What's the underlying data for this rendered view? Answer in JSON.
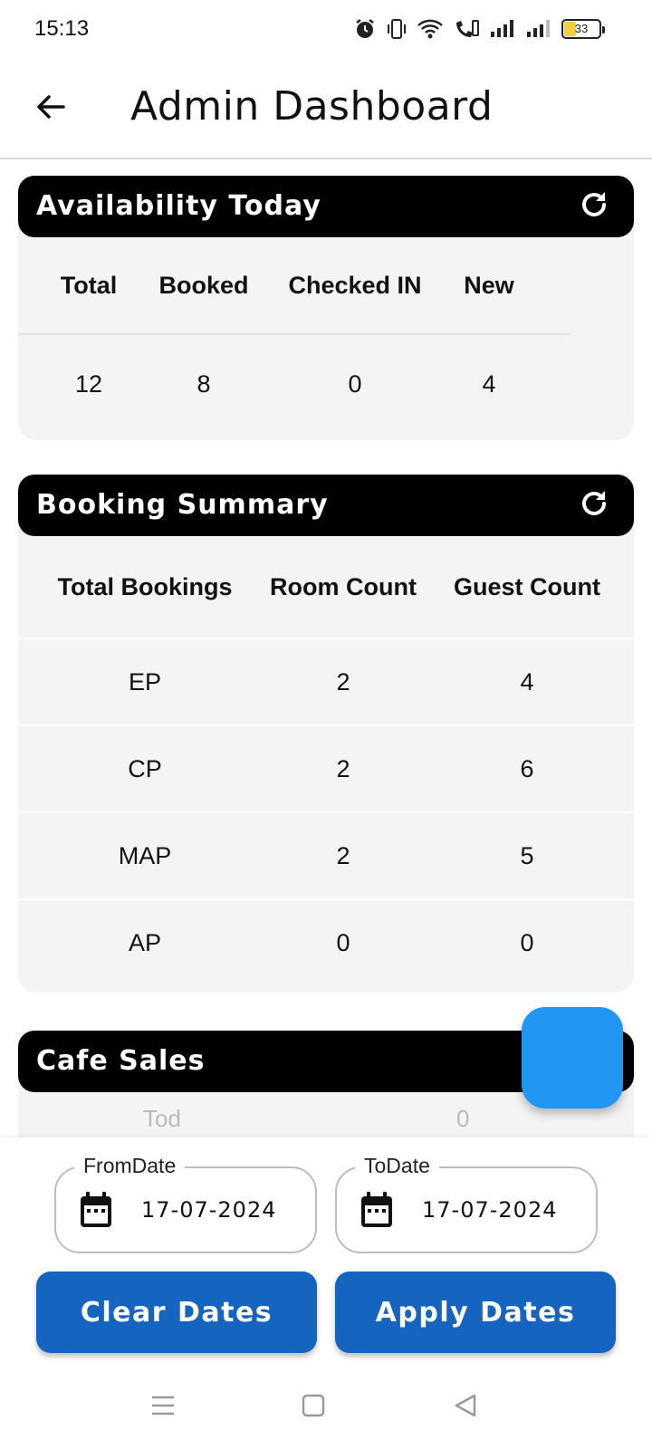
{
  "status_bar": {
    "time": "15:13",
    "battery_level": "33",
    "icons": [
      "alarm-icon",
      "vibrate-icon",
      "wifi-icon",
      "wifi-calling-icon",
      "signal-icon",
      "signal-icon",
      "battery-icon"
    ]
  },
  "app_bar": {
    "title": "Admin Dashboard",
    "back_icon": "arrow-left-icon"
  },
  "availability": {
    "title": "Availability Today",
    "refresh_icon": "refresh-icon",
    "headers": [
      "Total",
      "Booked",
      "Checked IN",
      "New"
    ],
    "values": [
      "12",
      "8",
      "0",
      "4"
    ]
  },
  "booking_summary": {
    "title": "Booking Summary",
    "refresh_icon": "refresh-icon",
    "headers": [
      "Total Bookings",
      "Room Count",
      "Guest Count"
    ],
    "rows": [
      [
        "EP",
        "2",
        "4"
      ],
      [
        "CP",
        "2",
        "6"
      ],
      [
        "MAP",
        "2",
        "5"
      ],
      [
        "AP",
        "0",
        "0"
      ]
    ]
  },
  "cafe_sales": {
    "title": "Cafe Sales",
    "peek_left": "Tod",
    "peek_right": "0"
  },
  "date_filter": {
    "from_label": "FromDate",
    "from_value": "17-07-2024",
    "to_label": "ToDate",
    "to_value": "17-07-2024",
    "clear_label": "Clear Dates",
    "apply_label": "Apply Dates"
  },
  "colors": {
    "header_bg": "#000000",
    "card_bg": "#f4f4f4",
    "fab": "#2196f3",
    "button": "#1565c0"
  }
}
